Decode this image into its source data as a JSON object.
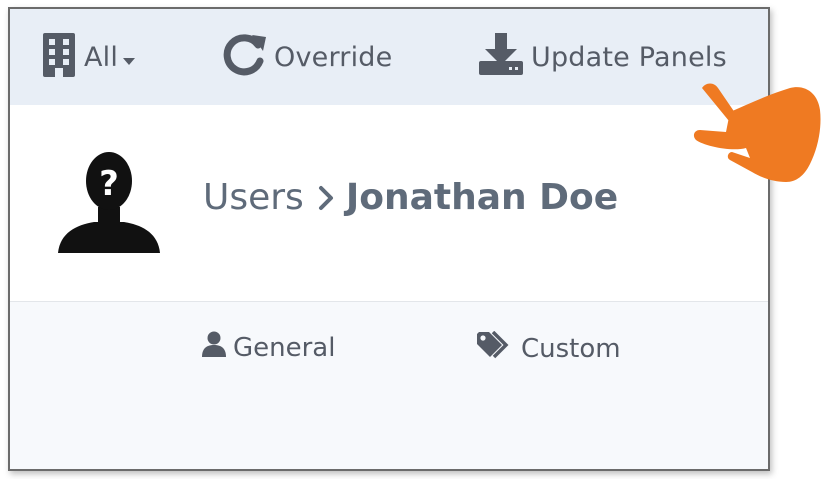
{
  "toolbar": {
    "building_filter_label": "All",
    "override_label": "Override",
    "update_panels_label": "Update Panels"
  },
  "breadcrumb": {
    "parent": "Users",
    "current": "Jonathan Doe"
  },
  "tabs": [
    {
      "label": "General",
      "icon": "user-icon"
    },
    {
      "label": "Custom",
      "icon": "tags-icon"
    }
  ],
  "colors": {
    "toolbar_bg": "#e8eef6",
    "text": "#555b66",
    "pointer_hand": "#ef7a22"
  }
}
